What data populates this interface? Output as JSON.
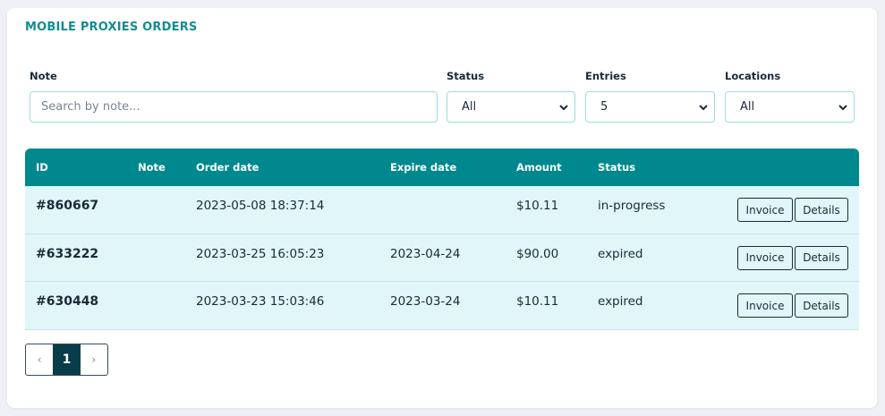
{
  "page": {
    "title": "MOBILE PROXIES ORDERS"
  },
  "filters": {
    "note": {
      "label": "Note",
      "placeholder": "Search by note..."
    },
    "status": {
      "label": "Status",
      "value": "All"
    },
    "entries": {
      "label": "Entries",
      "value": "5"
    },
    "locations": {
      "label": "Locations",
      "value": "All"
    }
  },
  "table": {
    "columns": {
      "id": "ID",
      "note": "Note",
      "order_date": "Order date",
      "expire_date": "Expire date",
      "amount": "Amount",
      "status": "Status"
    },
    "rows": [
      {
        "id": "#860667",
        "note": "",
        "order_date": "2023-05-08 18:37:14",
        "expire_date": "",
        "amount": "$10.11",
        "status": "in-progress",
        "invoice_label": "Invoice",
        "details_label": "Details"
      },
      {
        "id": "#633222",
        "note": "",
        "order_date": "2023-03-25 16:05:23",
        "expire_date": "2023-04-24",
        "amount": "$90.00",
        "status": "expired",
        "invoice_label": "Invoice",
        "details_label": "Details"
      },
      {
        "id": "#630448",
        "note": "",
        "order_date": "2023-03-23 15:03:46",
        "expire_date": "2023-03-24",
        "amount": "$10.11",
        "status": "expired",
        "invoice_label": "Invoice",
        "details_label": "Details"
      }
    ]
  },
  "pagination": {
    "prev": "‹",
    "current": "1",
    "next": "›"
  },
  "colors": {
    "accent": "#138c93",
    "header_bg": "#00888f",
    "row_bg": "#e0f6f9",
    "active_page": "#063d48"
  }
}
